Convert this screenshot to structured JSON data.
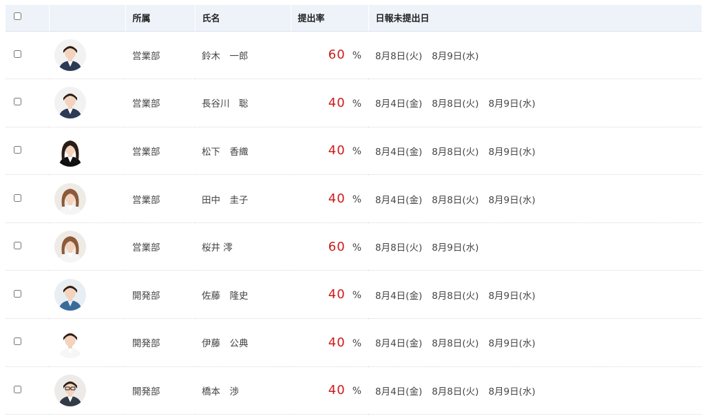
{
  "header": {
    "dept": "所属",
    "name": "氏名",
    "rate": "提出率",
    "missing": "日報未提出日"
  },
  "rate_unit": "%",
  "rows": [
    {
      "dept": "営業部",
      "name": "鈴木　一郎",
      "rate": "60",
      "dates": [
        "8月8日(火)",
        "8月9日(水)"
      ],
      "avatar": "male-suit"
    },
    {
      "dept": "営業部",
      "name": "長谷川　聡",
      "rate": "40",
      "dates": [
        "8月4日(金)",
        "8月8日(火)",
        "8月9日(水)"
      ],
      "avatar": "male-suit"
    },
    {
      "dept": "営業部",
      "name": "松下　香織",
      "rate": "40",
      "dates": [
        "8月4日(金)",
        "8月8日(火)",
        "8月9日(水)"
      ],
      "avatar": "female-dark"
    },
    {
      "dept": "営業部",
      "name": "田中　圭子",
      "rate": "40",
      "dates": [
        "8月4日(金)",
        "8月8日(火)",
        "8月9日(水)"
      ],
      "avatar": "female-light"
    },
    {
      "dept": "営業部",
      "name": "桜井 澪",
      "rate": "60",
      "dates": [
        "8月8日(火)",
        "8月9日(水)"
      ],
      "avatar": "female-light"
    },
    {
      "dept": "開発部",
      "name": "佐藤　隆史",
      "rate": "40",
      "dates": [
        "8月4日(金)",
        "8月8日(火)",
        "8月9日(水)"
      ],
      "avatar": "male-casual"
    },
    {
      "dept": "開発部",
      "name": "伊藤　公典",
      "rate": "40",
      "dates": [
        "8月4日(金)",
        "8月8日(火)",
        "8月9日(水)"
      ],
      "avatar": "male-shirt"
    },
    {
      "dept": "開発部",
      "name": "橋本　渉",
      "rate": "40",
      "dates": [
        "8月4日(金)",
        "8月8日(火)",
        "8月9日(水)"
      ],
      "avatar": "male-glasses"
    }
  ],
  "colors": {
    "header_bg": "#eef3fa",
    "rate_red": "#cc1a1a"
  }
}
